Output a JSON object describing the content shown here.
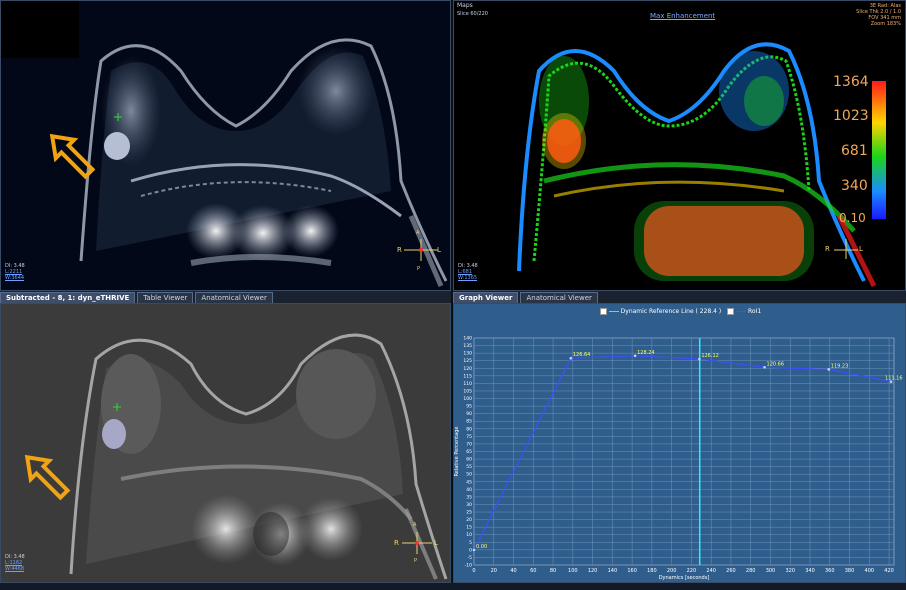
{
  "top_left": {
    "info": "DI: 3.48",
    "level": "L:2211",
    "width": "W:3644",
    "orientation": {
      "a": "A",
      "r": "R",
      "l": "L",
      "p": "P"
    }
  },
  "top_right": {
    "header_maps": "Maps",
    "header_slice": "Slice 60/220",
    "title": "Max Enhancement",
    "meta": [
      "3E Rad: Alas",
      "Slice Thk 2.0 / 1.0",
      "FOV 341 mm",
      "Zoom 183%"
    ],
    "info": "DI: 3.48",
    "level": "L:681",
    "width": "W:1365",
    "scale_labels": [
      "1364",
      "1023",
      "681",
      "340",
      "0.10"
    ],
    "orientation": {
      "r": "R",
      "l": "L"
    }
  },
  "tabs_left": [
    "Subtracted - 8, 1: dyn_eTHRIVE",
    "Table Viewer",
    "Anatomical Viewer"
  ],
  "tabs_right": [
    "Graph Viewer",
    "Anatomical Viewer"
  ],
  "bottom_left": {
    "info": "DI: 3.48",
    "level": "L:1162",
    "width": "W:4468",
    "orientation": {
      "a": "A",
      "r": "R",
      "l": "L",
      "p": "P"
    }
  },
  "graph": {
    "legend": [
      "Dynamic Reference Line ( 228.4 )",
      "RoI1"
    ],
    "xlabel": "Dynamics [seconds]",
    "ylabel": "Relative Percentage",
    "reference_x": 228.4
  },
  "chart_data": {
    "type": "line",
    "title": "",
    "xlabel": "Dynamics [seconds]",
    "ylabel": "Relative Percentage",
    "xlim": [
      0,
      425
    ],
    "ylim": [
      -10,
      140
    ],
    "x_ticks": [
      "0",
      "20",
      "40",
      "60",
      "80",
      "100",
      "120",
      "140",
      "160",
      "180",
      "200",
      "220",
      "240",
      "260",
      "280",
      "300",
      "320",
      "340",
      "360",
      "380",
      "400",
      "420"
    ],
    "y_ticks": [
      "-10",
      "-5",
      "0",
      "5",
      "10",
      "15",
      "20",
      "25",
      "30",
      "35",
      "40",
      "45",
      "50",
      "55",
      "60",
      "65",
      "70",
      "75",
      "80",
      "85",
      "90",
      "95",
      "100",
      "105",
      "110",
      "115",
      "120",
      "125",
      "130",
      "135",
      "140"
    ],
    "series": [
      {
        "name": "RoI1",
        "x": [
          0,
          98,
          163,
          228,
          294,
          359,
          422
        ],
        "y": [
          0,
          126.64,
          128.24,
          126.12,
          120.66,
          119.23,
          111.16
        ],
        "labels": [
          "0.00",
          "126.64",
          "128.24",
          "126.12",
          "120.66",
          "119.23",
          "111.16"
        ]
      }
    ],
    "reference_line_x": 228.4,
    "grid": true,
    "legend_position": "top-center",
    "colors": {
      "line": "#3c4fff",
      "reference": "#2fe8ff",
      "background": "#2f5e8d",
      "grid": "#6f93bb"
    }
  },
  "colors": {
    "arrow": "#f2a30f",
    "colorbar": [
      "#ff1a1a",
      "#ffd400",
      "#1ad41a",
      "#1a8cff",
      "#1a1aff"
    ]
  }
}
